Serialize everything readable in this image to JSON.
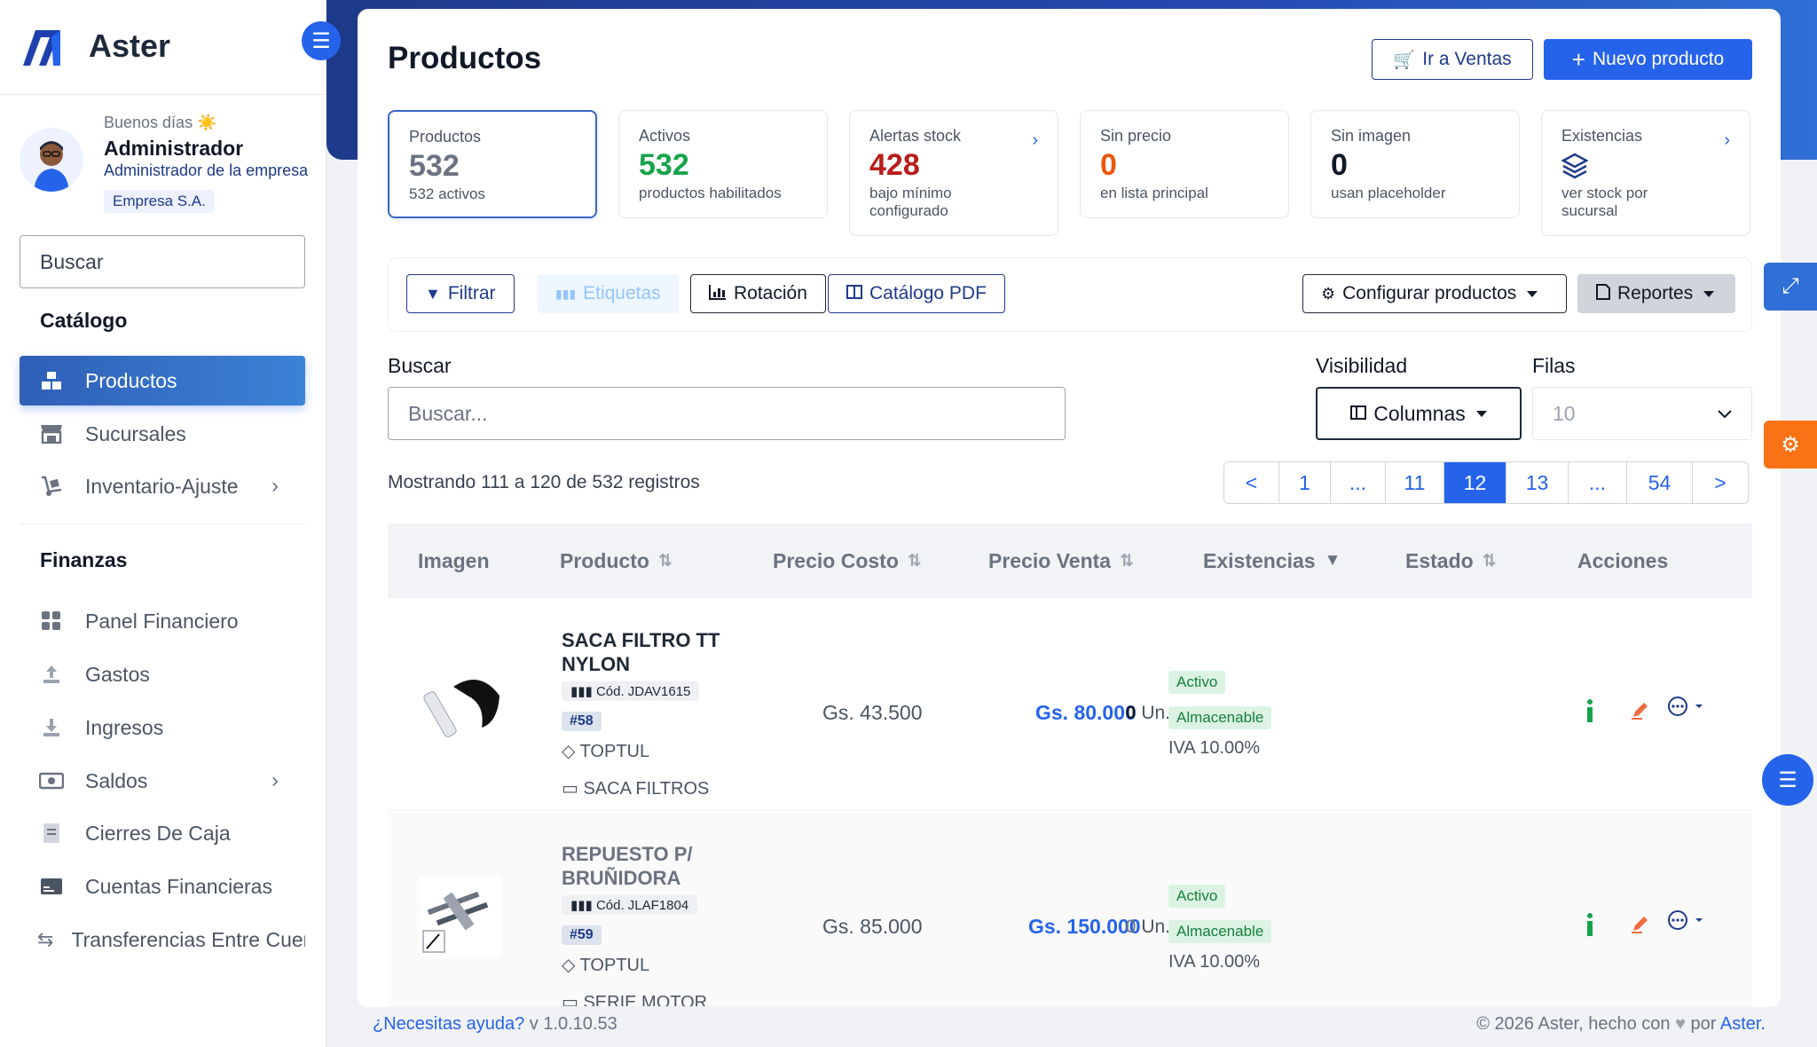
{
  "brand": {
    "name": "Aster"
  },
  "user": {
    "greeting": "Buenos días ☀️",
    "name": "Administrador",
    "role": "Administrador de la empresa",
    "company": "Empresa S.A."
  },
  "sidebar": {
    "search_value": "Buscar",
    "section_catalog": "Catálogo",
    "section_finance": "Finanzas",
    "items": [
      {
        "label": "Productos",
        "icon": "boxes-icon"
      },
      {
        "label": "Sucursales",
        "icon": "store-icon"
      },
      {
        "label": "Inventario-Ajuste",
        "icon": "dolly-icon"
      },
      {
        "label": "Panel Financiero",
        "icon": "grid-icon"
      },
      {
        "label": "Gastos",
        "icon": "upload-icon"
      },
      {
        "label": "Ingresos",
        "icon": "download-icon"
      },
      {
        "label": "Saldos",
        "icon": "money-icon"
      },
      {
        "label": "Cierres De Caja",
        "icon": "receipt-icon"
      },
      {
        "label": "Cuentas Financieras",
        "icon": "card-icon"
      },
      {
        "label": "Transferencias Entre Cuentas",
        "icon": "transfer-icon"
      }
    ]
  },
  "page": {
    "title": "Productos",
    "btn_sales": "Ir a Ventas",
    "btn_new": "Nuevo producto"
  },
  "stats": [
    {
      "label": "Productos",
      "value": "532",
      "sub": "532 activos",
      "color": "#6b7280"
    },
    {
      "label": "Activos",
      "value": "532",
      "sub": "productos habilitados",
      "color": "#16a34a"
    },
    {
      "label": "Alertas stock",
      "value": "428",
      "sub": "bajo mínimo configurado",
      "color": "#b91c1c"
    },
    {
      "label": "Sin precio",
      "value": "0",
      "sub": "en lista principal",
      "color": "#ea580c"
    },
    {
      "label": "Sin imagen",
      "value": "0",
      "sub": "usan placeholder",
      "color": "#111827"
    },
    {
      "label": "Existencias",
      "value": "",
      "sub": "ver stock por sucursal",
      "color": "#1e3a8a"
    }
  ],
  "toolbar": {
    "filter": "Filtrar",
    "labels": "Etiquetas",
    "rotation": "Rotación",
    "catalog_pdf": "Catálogo PDF",
    "configure": "Configurar productos",
    "reports": "Reportes"
  },
  "filters": {
    "search_label": "Buscar",
    "search_placeholder": "Buscar...",
    "visibility_label": "Visibilidad",
    "columns": "Columnas",
    "rows_label": "Filas",
    "rows_value": "10"
  },
  "pagination": {
    "showing": "Mostrando 111 a 120 de 532 registros",
    "pages": [
      "<",
      "1",
      "...",
      "11",
      "12",
      "13",
      "...",
      "54",
      ">"
    ],
    "current": "12"
  },
  "table": {
    "headers": [
      "Imagen",
      "Producto",
      "Precio Costo",
      "Precio Venta",
      "Existencias",
      "Estado",
      "Acciones"
    ],
    "rows": [
      {
        "name": "SACA FILTRO TT NYLON",
        "code": "Cód. JDAV1615",
        "tag": "#58",
        "brand": "TOPTUL",
        "category": "SACA FILTROS",
        "cost": "Gs. 43.500",
        "price": "Gs. 80.000",
        "stock_qty": "0",
        "stock_unit": "Un.",
        "status": "Activo",
        "storage": "Almacenable",
        "iva": "IVA 10.00%"
      },
      {
        "name": "REPUESTO P/ BRUÑIDORA",
        "code": "Cód. JLAF1804",
        "tag": "#59",
        "brand": "TOPTUL",
        "category": "SERIE MOTOR",
        "cost": "Gs. 85.000",
        "price": "Gs. 150.000",
        "stock_qty": "0",
        "stock_unit": "Un.",
        "status": "Activo",
        "storage": "Almacenable",
        "iva": "IVA 10.00%"
      }
    ]
  },
  "footer": {
    "help": "¿Necesitas ayuda?",
    "version": "v 1.0.10.53",
    "copyright": "© 2026 Aster, hecho con",
    "by": "por",
    "link": "Aster."
  },
  "colors": {
    "primary": "#2563eb",
    "navy": "#1e3a8a",
    "alert_orange": "#f97316"
  }
}
